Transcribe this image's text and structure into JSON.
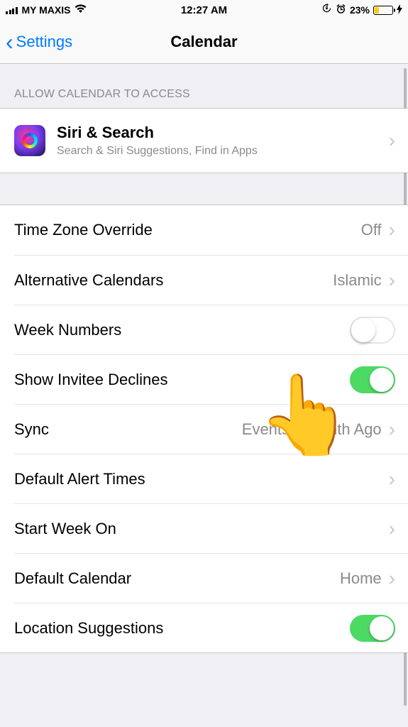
{
  "status_bar": {
    "carrier": "MY MAXIS",
    "time": "12:27 AM",
    "battery_pct": "23%"
  },
  "nav": {
    "back_label": "Settings",
    "title": "Calendar"
  },
  "section1": {
    "header": "ALLOW CALENDAR TO ACCESS",
    "siri": {
      "title": "Siri & Search",
      "subtitle": "Search & Siri Suggestions, Find in Apps"
    }
  },
  "settings": {
    "time_zone_override": {
      "label": "Time Zone Override",
      "value": "Off"
    },
    "alt_calendars": {
      "label": "Alternative Calendars",
      "value": "Islamic"
    },
    "week_numbers": {
      "label": "Week Numbers",
      "on": false
    },
    "show_invitee": {
      "label": "Show Invitee Declines",
      "on": true
    },
    "sync": {
      "label": "Sync",
      "value": "Events 1 Month Ago"
    },
    "default_alert": {
      "label": "Default Alert Times"
    },
    "start_week": {
      "label": "Start Week On"
    },
    "default_calendar": {
      "label": "Default Calendar",
      "value": "Home"
    },
    "location_sug": {
      "label": "Location Suggestions",
      "on": true
    }
  }
}
